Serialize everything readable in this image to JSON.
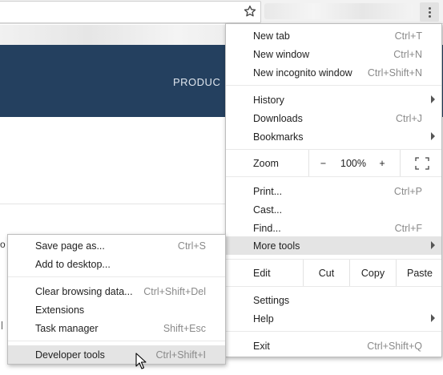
{
  "page": {
    "banner_text": "PRODUC",
    "partial_glyph_o": "o"
  },
  "toolbar": {
    "icons": [
      "star-icon",
      "menu-icon"
    ]
  },
  "main_menu": {
    "new_tab": {
      "label": "New tab",
      "shortcut": "Ctrl+T"
    },
    "new_window": {
      "label": "New window",
      "shortcut": "Ctrl+N"
    },
    "new_incognito": {
      "label": "New incognito window",
      "shortcut": "Ctrl+Shift+N"
    },
    "history": {
      "label": "History"
    },
    "downloads": {
      "label": "Downloads",
      "shortcut": "Ctrl+J"
    },
    "bookmarks": {
      "label": "Bookmarks"
    },
    "zoom": {
      "label": "Zoom",
      "minus": "−",
      "value": "100%",
      "plus": "+"
    },
    "print": {
      "label": "Print...",
      "shortcut": "Ctrl+P"
    },
    "cast": {
      "label": "Cast..."
    },
    "find": {
      "label": "Find...",
      "shortcut": "Ctrl+F"
    },
    "more_tools": {
      "label": "More tools"
    },
    "edit": {
      "label": "Edit",
      "cut": "Cut",
      "copy": "Copy",
      "paste": "Paste"
    },
    "settings": {
      "label": "Settings"
    },
    "help": {
      "label": "Help"
    },
    "exit": {
      "label": "Exit",
      "shortcut": "Ctrl+Shift+Q"
    }
  },
  "sub_menu": {
    "save_page": {
      "label": "Save page as...",
      "shortcut": "Ctrl+S"
    },
    "add_desktop": {
      "label": "Add to desktop..."
    },
    "clear_data": {
      "label": "Clear browsing data...",
      "shortcut": "Ctrl+Shift+Del"
    },
    "extensions": {
      "label": "Extensions"
    },
    "task_manager": {
      "label": "Task manager",
      "shortcut": "Shift+Esc"
    },
    "dev_tools": {
      "label": "Developer tools",
      "shortcut": "Ctrl+Shift+I"
    }
  },
  "colors": {
    "banner": "#24405f",
    "highlight": "#e4e4e4",
    "shortcut_text": "#8a8a8a"
  }
}
